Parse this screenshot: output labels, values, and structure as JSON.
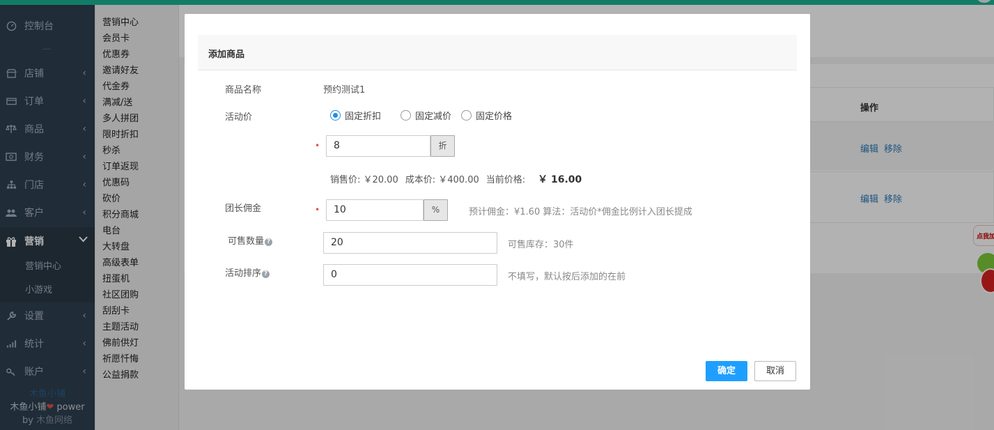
{
  "sidebar": {
    "items": [
      {
        "label": "控制台",
        "icon": "dashboard-icon"
      },
      {
        "label": "店铺",
        "icon": "shop-icon"
      },
      {
        "label": "订单",
        "icon": "order-icon"
      },
      {
        "label": "商品",
        "icon": "scale-icon"
      },
      {
        "label": "财务",
        "icon": "money-icon"
      },
      {
        "label": "门店",
        "icon": "sitemap-icon"
      },
      {
        "label": "客户",
        "icon": "users-icon"
      },
      {
        "label": "营销",
        "icon": "gift-icon"
      },
      {
        "label": "设置",
        "icon": "wrench-icon"
      },
      {
        "label": "统计",
        "icon": "bar-chart-icon"
      },
      {
        "label": "账户",
        "icon": "key-icon"
      }
    ],
    "subitems": [
      "营销中心",
      "小游戏"
    ],
    "brand": {
      "shop": "木鱼小铺",
      "line2_prefix": "木鱼小铺",
      "line2_suffix": " power",
      "line3_prefix": "by ",
      "line3_company": "木鱼网络"
    }
  },
  "submenu": [
    "营销中心",
    "会员卡",
    "优惠券",
    "邀请好友",
    "代金券",
    "满减/送",
    "多人拼团",
    "限时折扣",
    "秒杀",
    "订单返现",
    "优惠码",
    "砍价",
    "积分商城",
    "电台",
    "大转盘",
    "高级表单",
    "扭蛋机",
    "社区团购",
    "刮刮卡",
    "主题活动",
    "佛前供灯",
    "祈愿忏悔",
    "公益捐款"
  ],
  "background_table": {
    "op_header": "操作",
    "rows": [
      {
        "edit": "编辑",
        "remove": "移除"
      },
      {
        "edit": "编辑",
        "remove": "移除"
      }
    ],
    "badge_text": "点我加进"
  },
  "modal": {
    "title": "添加商品",
    "product_name_label": "商品名称",
    "product_name_value": "预约测试1",
    "activity_price_label": "活动价",
    "radios": [
      {
        "label": "固定折扣",
        "checked": true
      },
      {
        "label": "固定减价",
        "checked": false
      },
      {
        "label": "固定价格",
        "checked": false
      }
    ],
    "required_mark": "•",
    "discount_value": "8",
    "discount_unit": "折",
    "price_info": {
      "sale_price": "销售价: ￥20.00",
      "cost_price": "成本价: ￥400.00",
      "current_label": "当前价格:",
      "current_value": "￥ 16.00"
    },
    "commission_label": "团长佣金",
    "commission_value": "10",
    "commission_unit": "%",
    "commission_hint": "预计佣金：¥1.60 算法：活动价*佣金比例计入团长提成",
    "qty_label": "可售数量",
    "qty_value": "20",
    "qty_hint": "可售库存：30件",
    "sort_label": "活动排序",
    "sort_value": "0",
    "sort_hint": "不填写，默认按后添加的在前",
    "help_glyph": "?",
    "ok_label": "确定",
    "cancel_label": "取消",
    "colors": {
      "primary": "#1e9fff",
      "required": "#e04c4c"
    }
  }
}
